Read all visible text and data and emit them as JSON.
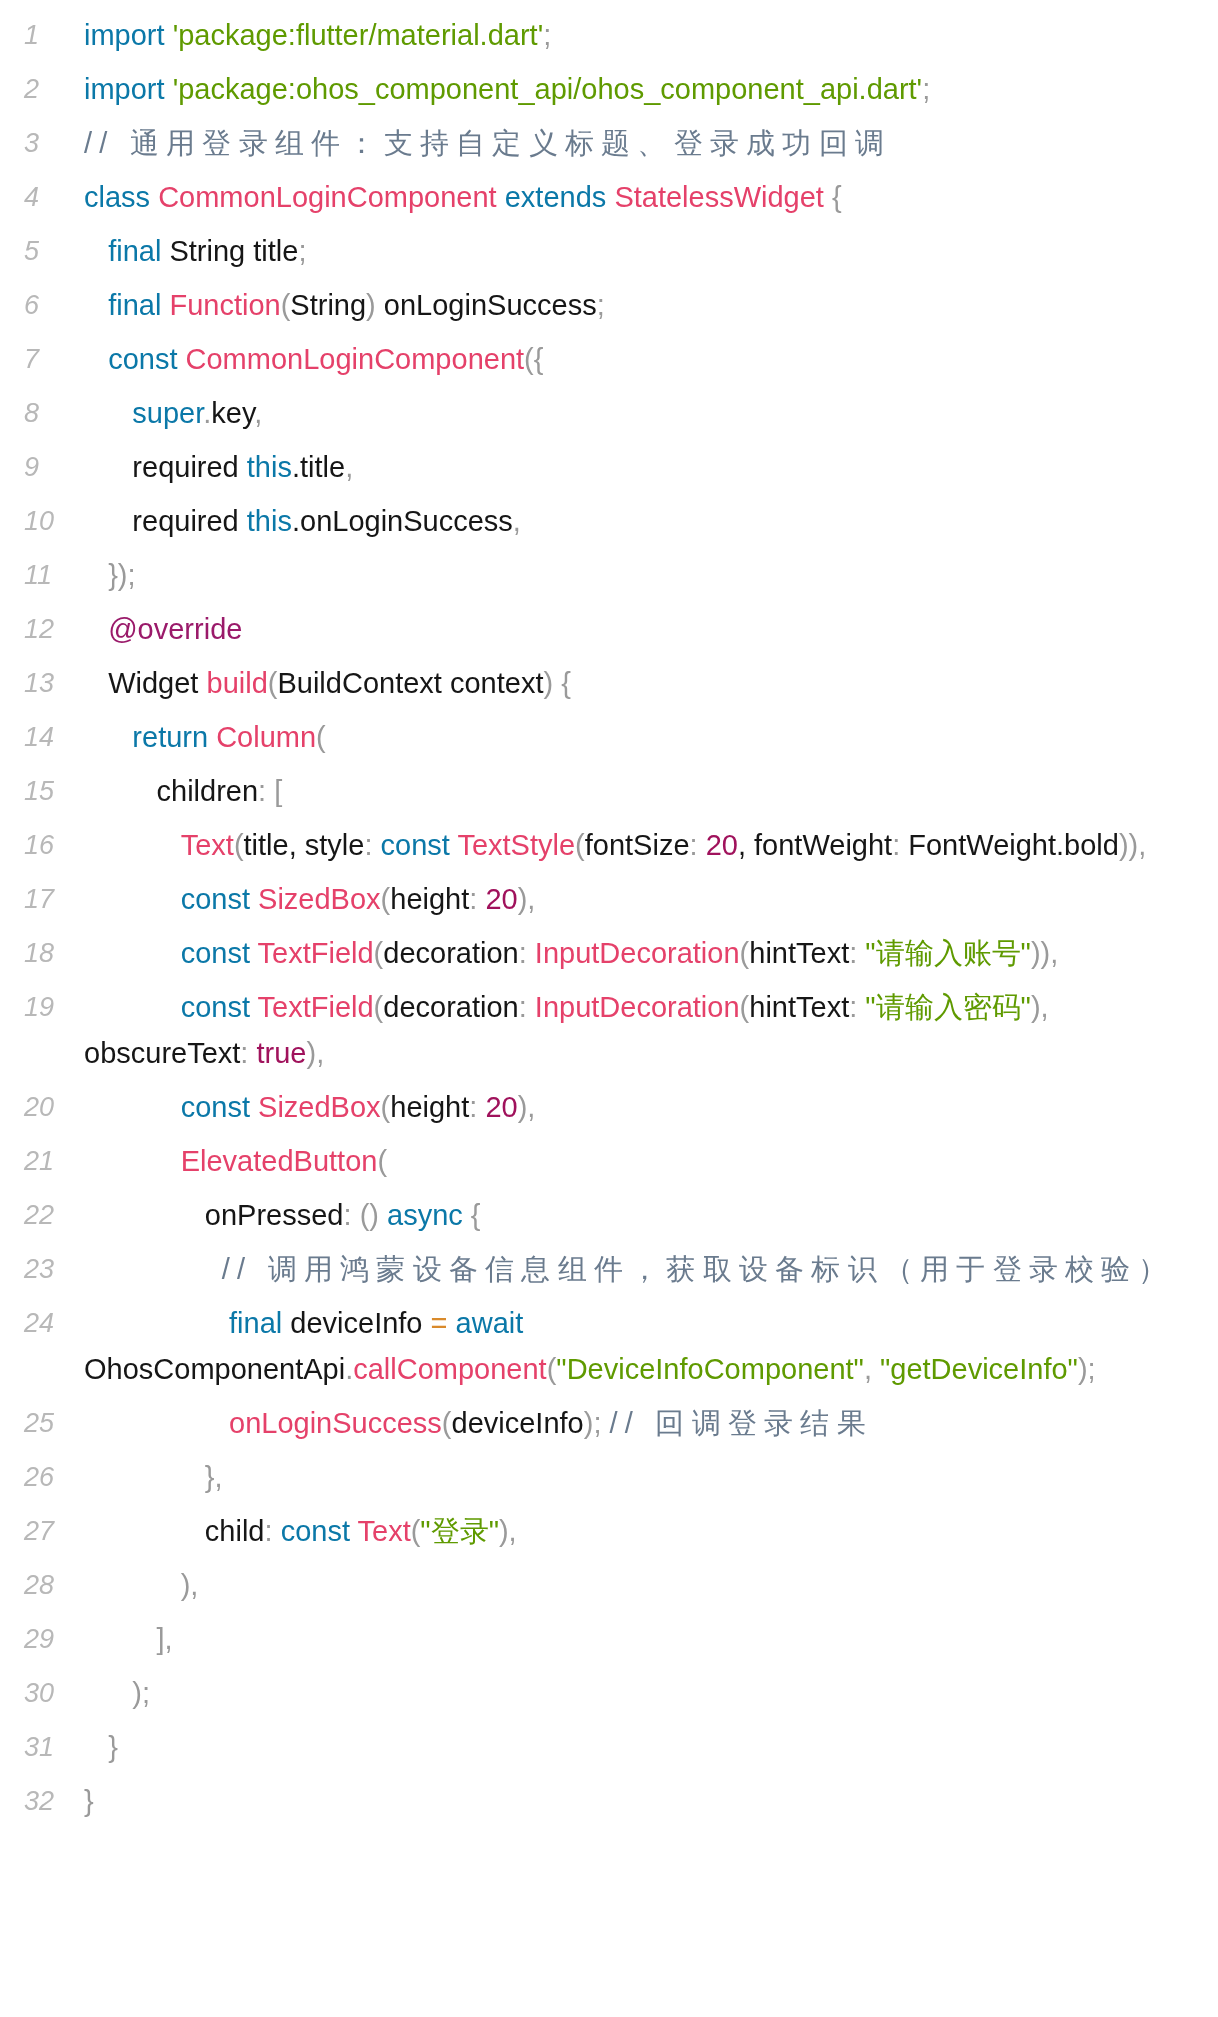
{
  "lines": [
    {
      "number": "1",
      "tokens": [
        {
          "text": "import ",
          "kind": "keyword"
        },
        {
          "text": "'package:flutter/material.dart'",
          "kind": "string"
        },
        {
          "text": ";",
          "kind": "punctuation"
        }
      ]
    },
    {
      "number": "2",
      "tokens": [
        {
          "text": "import ",
          "kind": "keyword"
        },
        {
          "text": "'package:ohos_component_api/ohos_component_api.dart'",
          "kind": "string"
        },
        {
          "text": ";",
          "kind": "punctuation"
        }
      ]
    },
    {
      "number": "3",
      "tokens": [
        {
          "text": "// 通用登录组件：支持自定义标题、登录成功回调",
          "kind": "comment"
        }
      ]
    },
    {
      "number": "4",
      "tokens": [
        {
          "text": "class ",
          "kind": "keyword"
        },
        {
          "text": "CommonLoginComponent ",
          "kind": "type"
        },
        {
          "text": "extends ",
          "kind": "keyword"
        },
        {
          "text": "StatelessWidget ",
          "kind": "type"
        },
        {
          "text": "{",
          "kind": "punctuation"
        }
      ]
    },
    {
      "number": "5",
      "tokens": [
        {
          "text": "   final ",
          "kind": "keyword"
        },
        {
          "text": "String title",
          "kind": "plain"
        },
        {
          "text": ";",
          "kind": "punctuation"
        }
      ]
    },
    {
      "number": "6",
      "tokens": [
        {
          "text": "   final ",
          "kind": "keyword"
        },
        {
          "text": "Function",
          "kind": "type"
        },
        {
          "text": "(",
          "kind": "punctuation"
        },
        {
          "text": "String",
          "kind": "plain"
        },
        {
          "text": ") ",
          "kind": "punctuation"
        },
        {
          "text": "onLoginSuccess",
          "kind": "plain"
        },
        {
          "text": ";",
          "kind": "punctuation"
        }
      ]
    },
    {
      "number": "7",
      "tokens": [
        {
          "text": "   const ",
          "kind": "keyword"
        },
        {
          "text": "CommonLoginComponent",
          "kind": "type"
        },
        {
          "text": "({",
          "kind": "punctuation"
        }
      ]
    },
    {
      "number": "8",
      "tokens": [
        {
          "text": "      super",
          "kind": "keyword"
        },
        {
          "text": ".",
          "kind": "punctuation"
        },
        {
          "text": "key",
          "kind": "plain"
        },
        {
          "text": ",",
          "kind": "punctuation"
        }
      ]
    },
    {
      "number": "9",
      "tokens": [
        {
          "text": "      required ",
          "kind": "plain"
        },
        {
          "text": "this",
          "kind": "keyword"
        },
        {
          "text": ".title",
          "kind": "plain"
        },
        {
          "text": ",",
          "kind": "punctuation"
        }
      ]
    },
    {
      "number": "10",
      "tokens": [
        {
          "text": "      required ",
          "kind": "plain"
        },
        {
          "text": "this",
          "kind": "keyword"
        },
        {
          "text": ".onLoginSuccess",
          "kind": "plain"
        },
        {
          "text": ",",
          "kind": "punctuation"
        }
      ]
    },
    {
      "number": "11",
      "tokens": [
        {
          "text": "   });",
          "kind": "punctuation"
        }
      ]
    },
    {
      "number": "12",
      "tokens": [
        {
          "text": "   @override",
          "kind": "annotation"
        }
      ]
    },
    {
      "number": "13",
      "tokens": [
        {
          "text": "   Widget ",
          "kind": "plain"
        },
        {
          "text": "build",
          "kind": "type"
        },
        {
          "text": "(",
          "kind": "punctuation"
        },
        {
          "text": "BuildContext context",
          "kind": "plain"
        },
        {
          "text": ") {",
          "kind": "punctuation"
        }
      ]
    },
    {
      "number": "14",
      "tokens": [
        {
          "text": "      return ",
          "kind": "keyword"
        },
        {
          "text": "Column",
          "kind": "type"
        },
        {
          "text": "(",
          "kind": "punctuation"
        }
      ]
    },
    {
      "number": "15",
      "tokens": [
        {
          "text": "         children",
          "kind": "plain"
        },
        {
          "text": ": [",
          "kind": "punctuation"
        }
      ]
    },
    {
      "number": "16",
      "tokens": [
        {
          "text": "            Text",
          "kind": "type"
        },
        {
          "text": "(",
          "kind": "punctuation"
        },
        {
          "text": "title, style",
          "kind": "plain"
        },
        {
          "text": ": ",
          "kind": "punctuation"
        },
        {
          "text": "const ",
          "kind": "keyword"
        },
        {
          "text": "TextStyle",
          "kind": "type"
        },
        {
          "text": "(",
          "kind": "punctuation"
        },
        {
          "text": "fontSize",
          "kind": "plain"
        },
        {
          "text": ": ",
          "kind": "punctuation"
        },
        {
          "text": "20",
          "kind": "number"
        },
        {
          "text": ", fontWeight",
          "kind": "plain"
        },
        {
          "text": ": ",
          "kind": "punctuation"
        },
        {
          "text": "FontWeight.bold",
          "kind": "plain"
        },
        {
          "text": ")),",
          "kind": "punctuation"
        }
      ]
    },
    {
      "number": "17",
      "tokens": [
        {
          "text": "            const ",
          "kind": "keyword"
        },
        {
          "text": "SizedBox",
          "kind": "type"
        },
        {
          "text": "(",
          "kind": "punctuation"
        },
        {
          "text": "height",
          "kind": "plain"
        },
        {
          "text": ": ",
          "kind": "punctuation"
        },
        {
          "text": "20",
          "kind": "number"
        },
        {
          "text": "),",
          "kind": "punctuation"
        }
      ]
    },
    {
      "number": "18",
      "tokens": [
        {
          "text": "            const ",
          "kind": "keyword"
        },
        {
          "text": "TextField",
          "kind": "type"
        },
        {
          "text": "(",
          "kind": "punctuation"
        },
        {
          "text": "decoration",
          "kind": "plain"
        },
        {
          "text": ": ",
          "kind": "punctuation"
        },
        {
          "text": "InputDecoration",
          "kind": "type"
        },
        {
          "text": "(",
          "kind": "punctuation"
        },
        {
          "text": "hintText",
          "kind": "plain"
        },
        {
          "text": ": ",
          "kind": "punctuation"
        },
        {
          "text": "\"请输入账号\"",
          "kind": "string"
        },
        {
          "text": ")),",
          "kind": "punctuation"
        }
      ]
    },
    {
      "number": "19",
      "tokens": [
        {
          "text": "            const ",
          "kind": "keyword"
        },
        {
          "text": "TextField",
          "kind": "type"
        },
        {
          "text": "(",
          "kind": "punctuation"
        },
        {
          "text": "decoration",
          "kind": "plain"
        },
        {
          "text": ": ",
          "kind": "punctuation"
        },
        {
          "text": "InputDecoration",
          "kind": "type"
        },
        {
          "text": "(",
          "kind": "punctuation"
        },
        {
          "text": "hintText",
          "kind": "plain"
        },
        {
          "text": ": ",
          "kind": "punctuation"
        },
        {
          "text": "\"请输入密码\"",
          "kind": "string"
        },
        {
          "text": "), ",
          "kind": "punctuation"
        },
        {
          "text": "obscureText",
          "kind": "plain"
        },
        {
          "text": ": ",
          "kind": "punctuation"
        },
        {
          "text": "true",
          "kind": "number"
        },
        {
          "text": "),",
          "kind": "punctuation"
        }
      ]
    },
    {
      "number": "20",
      "tokens": [
        {
          "text": "            const ",
          "kind": "keyword"
        },
        {
          "text": "SizedBox",
          "kind": "type"
        },
        {
          "text": "(",
          "kind": "punctuation"
        },
        {
          "text": "height",
          "kind": "plain"
        },
        {
          "text": ": ",
          "kind": "punctuation"
        },
        {
          "text": "20",
          "kind": "number"
        },
        {
          "text": "),",
          "kind": "punctuation"
        }
      ]
    },
    {
      "number": "21",
      "tokens": [
        {
          "text": "            ElevatedButton",
          "kind": "type"
        },
        {
          "text": "(",
          "kind": "punctuation"
        }
      ]
    },
    {
      "number": "22",
      "tokens": [
        {
          "text": "               onPressed",
          "kind": "plain"
        },
        {
          "text": ": () ",
          "kind": "punctuation"
        },
        {
          "text": "async ",
          "kind": "keyword"
        },
        {
          "text": "{",
          "kind": "punctuation"
        }
      ]
    },
    {
      "number": "23",
      "tokens": [
        {
          "text": "         // 调用鸿蒙设备信息组件，获取设备标识（用于登录校验）",
          "kind": "comment"
        }
      ]
    },
    {
      "number": "24",
      "tokens": [
        {
          "text": "                  final ",
          "kind": "keyword"
        },
        {
          "text": "deviceInfo ",
          "kind": "plain"
        },
        {
          "text": "= ",
          "kind": "operator"
        },
        {
          "text": "await ",
          "kind": "keyword"
        },
        {
          "text": "OhosComponentApi",
          "kind": "plain"
        },
        {
          "text": ".",
          "kind": "punctuation"
        },
        {
          "text": "callComponent",
          "kind": "type"
        },
        {
          "text": "(",
          "kind": "punctuation"
        },
        {
          "text": "\"DeviceInfoComponent\"",
          "kind": "string"
        },
        {
          "text": ", ",
          "kind": "punctuation"
        },
        {
          "text": "\"getDeviceInfo\"",
          "kind": "string"
        },
        {
          "text": ");",
          "kind": "punctuation"
        }
      ]
    },
    {
      "number": "25",
      "tokens": [
        {
          "text": "                  onLoginSuccess",
          "kind": "type"
        },
        {
          "text": "(",
          "kind": "punctuation"
        },
        {
          "text": "deviceInfo",
          "kind": "plain"
        },
        {
          "text": "); ",
          "kind": "punctuation"
        },
        {
          "text": "// 回调登录结果",
          "kind": "comment"
        }
      ]
    },
    {
      "number": "26",
      "tokens": [
        {
          "text": "               },",
          "kind": "punctuation"
        }
      ]
    },
    {
      "number": "27",
      "tokens": [
        {
          "text": "               child",
          "kind": "plain"
        },
        {
          "text": ": ",
          "kind": "punctuation"
        },
        {
          "text": "const ",
          "kind": "keyword"
        },
        {
          "text": "Text",
          "kind": "type"
        },
        {
          "text": "(",
          "kind": "punctuation"
        },
        {
          "text": "\"登录\"",
          "kind": "string"
        },
        {
          "text": "),",
          "kind": "punctuation"
        }
      ]
    },
    {
      "number": "28",
      "tokens": [
        {
          "text": "            ),",
          "kind": "punctuation"
        }
      ]
    },
    {
      "number": "29",
      "tokens": [
        {
          "text": "         ],",
          "kind": "punctuation"
        }
      ]
    },
    {
      "number": "30",
      "tokens": [
        {
          "text": "      );",
          "kind": "punctuation"
        }
      ]
    },
    {
      "number": "31",
      "tokens": [
        {
          "text": "   }",
          "kind": "punctuation"
        }
      ]
    },
    {
      "number": "32",
      "tokens": [
        {
          "text": "}",
          "kind": "punctuation"
        }
      ]
    }
  ]
}
